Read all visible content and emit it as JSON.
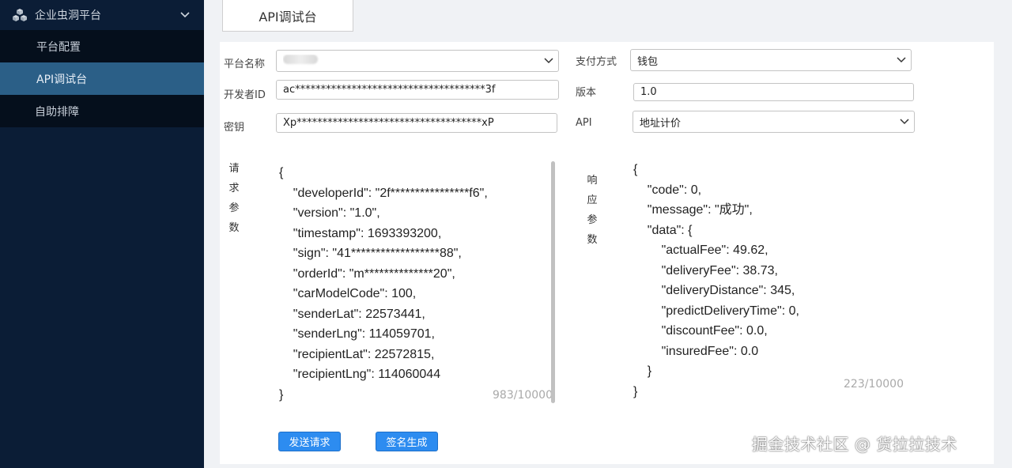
{
  "sidebar": {
    "title": "企业虫洞平台",
    "items": [
      {
        "label": "平台配置"
      },
      {
        "label": "API调试台"
      },
      {
        "label": "自助排障"
      }
    ]
  },
  "tab": {
    "label": "API调试台"
  },
  "form": {
    "platform_name_label": "平台名称",
    "developer_id_label": "开发者ID",
    "developer_id_value": "ac*************************************3f",
    "secret_label": "密钥",
    "secret_value": "Xp************************************xP",
    "payment_label": "支付方式",
    "payment_value": "钱包",
    "version_label": "版本",
    "version_value": "1.0",
    "api_label": "API",
    "api_value": "地址计价"
  },
  "request": {
    "label_chars": [
      "请",
      "求",
      "参",
      "数"
    ],
    "body": "{\n    \"developerId\": \"2f****************f6\",\n    \"version\": \"1.0\",\n    \"timestamp\": 1693393200,\n    \"sign\": \"41******************88\",\n    \"orderId\": \"m**************20\",\n    \"carModelCode\": 100,\n    \"senderLat\": 22573441,\n    \"senderLng\": 114059701,\n    \"recipientLat\": 22572815,\n    \"recipientLng\": 114060044\n}",
    "counter": "983/10000"
  },
  "response": {
    "label_chars": [
      "响",
      "应",
      "参",
      "数"
    ],
    "body": "{\n    \"code\": 0,\n    \"message\": \"成功\",\n    \"data\": {\n        \"actualFee\": 49.62,\n        \"deliveryFee\": 38.73,\n        \"deliveryDistance\": 345,\n        \"predictDeliveryTime\": 0,\n        \"discountFee\": 0.0,\n        \"insuredFee\": 0.0\n    }\n}",
    "counter": "223/10000"
  },
  "buttons": {
    "send_label": "发送请求",
    "sign_label": "签名生成"
  },
  "watermark": "掘金技术社区 @ 货拉拉技术",
  "colors": {
    "sidebar_bg": "#0b1d36",
    "active_item": "#2b5f87",
    "primary_button": "#2d8cf0"
  }
}
